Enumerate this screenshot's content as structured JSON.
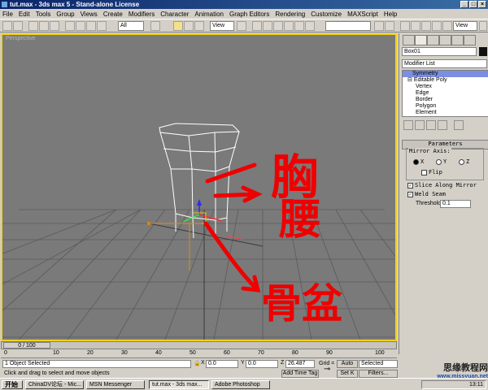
{
  "window": {
    "title": "tut.max - 3ds max 5 - Stand-alone License",
    "min": "_",
    "max": "□",
    "close": "×"
  },
  "menu": [
    "File",
    "Edit",
    "Tools",
    "Group",
    "Views",
    "Create",
    "Modifiers",
    "Character",
    "Animation",
    "Graph Editors",
    "Rendering",
    "Customize",
    "MAXScript",
    "Help"
  ],
  "toolbar": {
    "selection_filter": "All",
    "ref_coord": "View",
    "named_sel": "",
    "right_view": "View"
  },
  "viewport": {
    "label": "Perspective",
    "annotations": [
      "胸",
      "腰",
      "骨盆"
    ]
  },
  "command_panel": {
    "object_name": "Box01",
    "object_color": "#111111",
    "modifier_list": "Modifier List",
    "stack": [
      {
        "label": "Symmetry",
        "selected": true
      },
      {
        "label": "Editable Poly",
        "selected": false
      },
      {
        "label": "Vertex",
        "selected": false
      },
      {
        "label": "Edge",
        "selected": false
      },
      {
        "label": "Border",
        "selected": false
      },
      {
        "label": "Polygon",
        "selected": false
      },
      {
        "label": "Element",
        "selected": false
      }
    ],
    "rollout_title": "Parameters",
    "mirror_axis_label": "Mirror Axis:",
    "axis_x": "X",
    "axis_y": "Y",
    "axis_z": "Z",
    "flip": "Flip",
    "slice": "Slice Along Mirror",
    "weld": "Weld Seam",
    "threshold_label": "Threshold:",
    "threshold_value": "0.1"
  },
  "timeline": {
    "slider": "0 / 100",
    "ticks": [
      "0",
      "10",
      "20",
      "30",
      "40",
      "50",
      "60",
      "70",
      "80",
      "90",
      "100"
    ]
  },
  "status": {
    "selection": "1 Object Selected",
    "prompt": "Click and drag to select and move objects",
    "x_label": "X",
    "x_value": "0.0",
    "y_label": "Y",
    "y_value": "0.0",
    "z_label": "Z",
    "z_value": "26.487",
    "grid": "Grid = 10.0",
    "add_time_tag": "Add Time Tag",
    "auto": "Auto",
    "set_k": "Set K",
    "selected": "Selected",
    "filters": "Filters..."
  },
  "taskbar": {
    "start": "开始",
    "tasks": [
      {
        "label": "ChinaDV论坛 - Mic...",
        "active": false
      },
      {
        "label": "MSN Messenger",
        "active": false
      },
      {
        "label": "tut.max - 3ds max...",
        "active": true
      },
      {
        "label": "Adobe Photoshop",
        "active": false
      }
    ],
    "clock": "13:11"
  },
  "watermark": {
    "line1": "思缘教程网",
    "line2": "www.missyuan.net"
  }
}
